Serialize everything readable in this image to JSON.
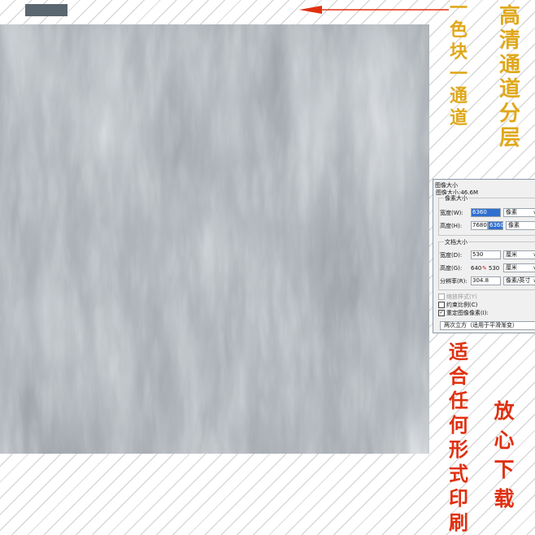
{
  "colors": {
    "accent_yellow": "#e0a81a",
    "accent_red": "#e03010",
    "texture_base": "#6d757d",
    "swatch": "#5a6670"
  },
  "texts": {
    "yellow_left": [
      "一",
      "色",
      "块",
      "一",
      "通",
      "道"
    ],
    "yellow_right": [
      "高",
      "清",
      "通",
      "道",
      "分",
      "层"
    ],
    "red_left": [
      "适",
      "合",
      "任",
      "何",
      "形",
      "式",
      "印",
      "刷"
    ],
    "red_right": [
      "放",
      "心",
      "下",
      "载"
    ]
  },
  "dialog": {
    "title": "图像大小",
    "image_size": "图像大小:46.6M",
    "pixel_group": "像素大小",
    "width_label": "宽度(W):",
    "width_value": "6360",
    "height_label": "高度(H):",
    "height_value": "7680",
    "height_value2": "6360",
    "unit_pixel": "像素",
    "doc_group": "文档大小",
    "doc_width_label": "宽度(D):",
    "doc_width_value": "530",
    "doc_height_label": "高度(G):",
    "doc_height_value": "640",
    "doc_height_value2": "530",
    "resolution_label": "分辨率(R):",
    "resolution_value": "304.8",
    "unit_cm": "厘米",
    "unit_res": "像素/英寸",
    "scale_styles": "缩放样式(Y)",
    "constrain": "约束比例(C)",
    "resample": "重定图像像素(I):",
    "resample_method": "两次立方（适用于平滑渐变）"
  }
}
